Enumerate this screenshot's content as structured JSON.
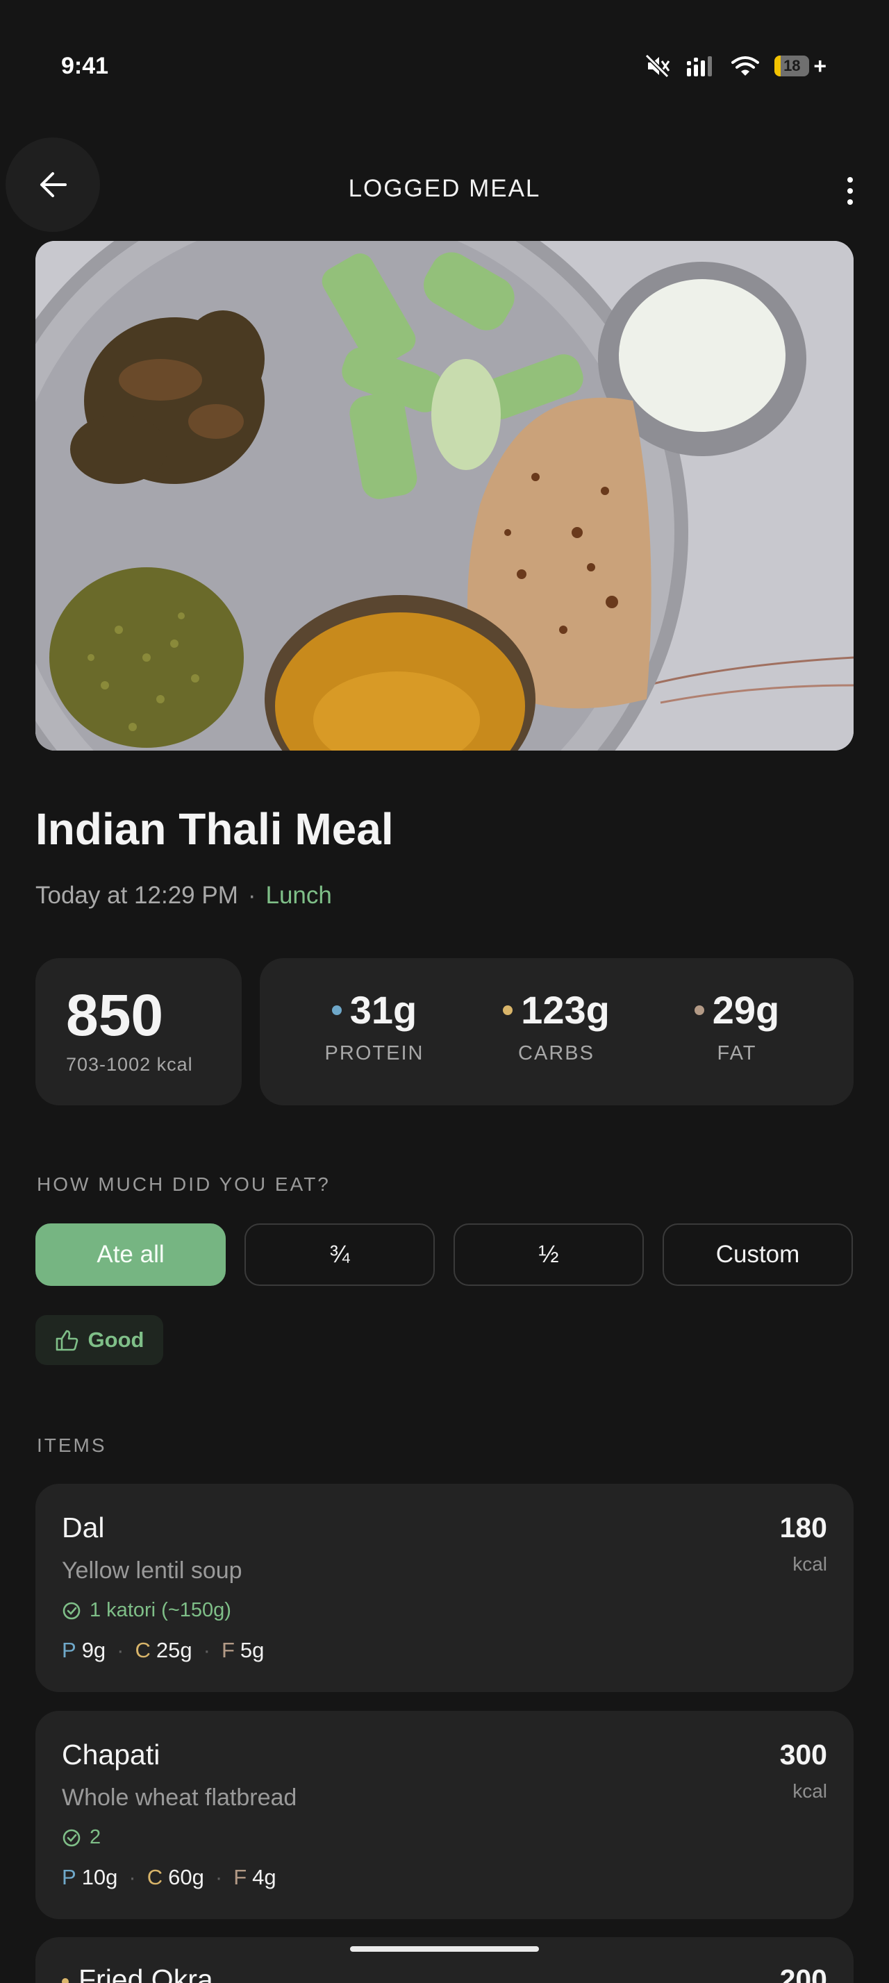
{
  "status_bar": {
    "time": "9:41",
    "battery": "18"
  },
  "header": {
    "title": "LOGGED MEAL"
  },
  "meal": {
    "title": "Indian Thali Meal",
    "time": "Today at 12:29 PM",
    "separator": "·",
    "type": "Lunch"
  },
  "nutrition": {
    "kcal": "850",
    "kcal_range": "703-1002 kcal",
    "macros": [
      {
        "value": "31g",
        "label": "PROTEIN",
        "color": "#6fa8c9"
      },
      {
        "value": "123g",
        "label": "CARBS",
        "color": "#d9b56a"
      },
      {
        "value": "29g",
        "label": "FAT",
        "color": "#b39a86"
      }
    ]
  },
  "portion": {
    "label": "HOW MUCH DID YOU EAT?",
    "options": [
      "Ate all",
      "¾",
      "½",
      "Custom"
    ],
    "selected": "Ate all",
    "rating": "Good"
  },
  "items_label": "ITEMS",
  "items": [
    {
      "name": "Dal",
      "desc": "Yellow lentil soup",
      "portion": "1 katori (~150g)",
      "kcal": "180",
      "kcal_unit": "kcal",
      "p_letter": "P",
      "p": "9g",
      "c_letter": "C",
      "c": "25g",
      "f_letter": "F",
      "f": "5g"
    },
    {
      "name": "Chapati",
      "desc": "Whole wheat flatbread",
      "portion": "2",
      "kcal": "300",
      "kcal_unit": "kcal",
      "p_letter": "P",
      "p": "10g",
      "c_letter": "C",
      "c": "60g",
      "f_letter": "F",
      "f": "4g"
    },
    {
      "name": "Fried Okra",
      "kcal": "200"
    }
  ],
  "colors": {
    "accent": "#76b582",
    "background": "#151515",
    "card": "#232323"
  },
  "icons": [
    "back-arrow-icon",
    "more-vertical-icon",
    "mute-icon",
    "signal-icon",
    "wifi-icon",
    "battery-icon",
    "thumbs-up-icon",
    "check-circle-icon"
  ]
}
